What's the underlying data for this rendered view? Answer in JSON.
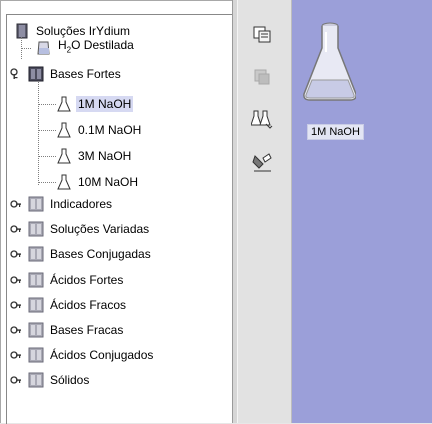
{
  "tree": {
    "root": {
      "label": "Soluções IrYdium",
      "icon": "root-folder-icon"
    },
    "items": [
      {
        "label": "H₂O Destilada",
        "icon": "beaker-icon",
        "type": "leaf"
      },
      {
        "label": "Bases Fortes",
        "icon": "open-folder-icon",
        "type": "folder",
        "expanded": true,
        "children": [
          {
            "label": "1M NaOH",
            "icon": "flask-icon",
            "selected": true
          },
          {
            "label": "0.1M NaOH",
            "icon": "flask-icon"
          },
          {
            "label": "3M NaOH",
            "icon": "flask-icon"
          },
          {
            "label": "10M NaOH",
            "icon": "flask-icon"
          }
        ]
      },
      {
        "label": "Indicadores",
        "icon": "closed-folder-icon",
        "type": "folder"
      },
      {
        "label": "Soluções Variadas",
        "icon": "closed-folder-icon",
        "type": "folder"
      },
      {
        "label": "Bases Conjugadas",
        "icon": "closed-folder-icon",
        "type": "folder"
      },
      {
        "label": "Ácidos Fortes",
        "icon": "closed-folder-icon",
        "type": "folder"
      },
      {
        "label": "Ácidos Fracos",
        "icon": "closed-folder-icon",
        "type": "folder"
      },
      {
        "label": "Bases Fracas",
        "icon": "closed-folder-icon",
        "type": "folder"
      },
      {
        "label": "Ácidos Conjugados",
        "icon": "closed-folder-icon",
        "type": "folder"
      },
      {
        "label": "Sólidos",
        "icon": "closed-folder-icon",
        "type": "folder"
      }
    ]
  },
  "toolbar": {
    "tools": [
      {
        "icon": "copy-solution-icon",
        "enabled": true
      },
      {
        "icon": "paste-solution-icon",
        "enabled": false
      },
      {
        "icon": "mix-solutions-icon",
        "enabled": true
      },
      {
        "icon": "properties-icon",
        "enabled": true
      }
    ]
  },
  "workbench": {
    "items": [
      {
        "label": "1M NaOH",
        "icon": "erlenmeyer-flask-icon"
      }
    ]
  },
  "colors": {
    "workbench_bg": "#9b9fd9",
    "selection_bg": "#d6d9f2",
    "tree_bg": "#ffffff"
  }
}
